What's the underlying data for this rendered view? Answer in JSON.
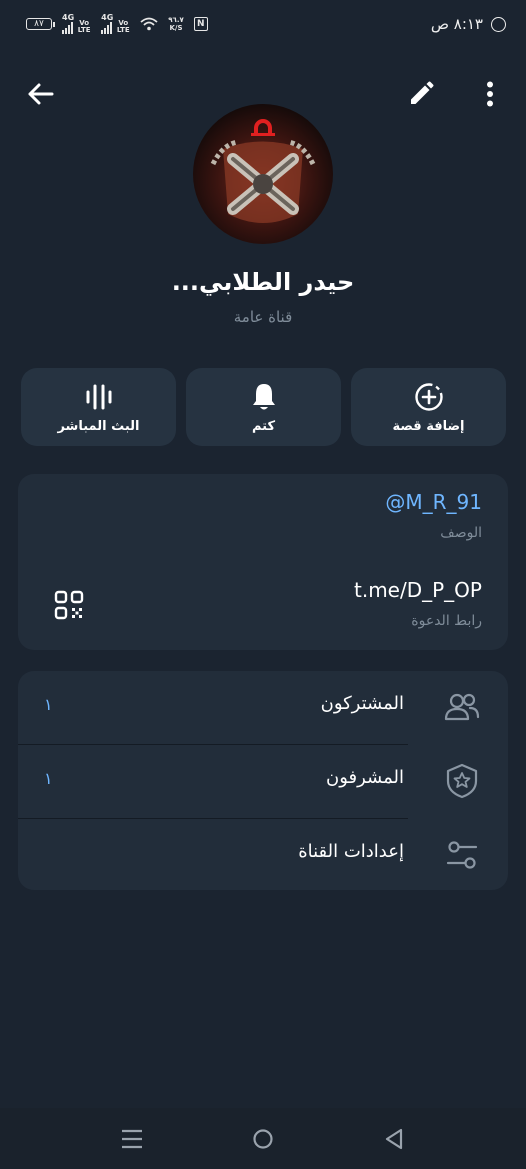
{
  "status_bar": {
    "battery": "٨٧",
    "sim1_net": "4G",
    "sim1_volte": "Vo LTE",
    "sim2_net": "4G",
    "sim2_volte": "Vo LTE",
    "net_speed_value": "٩٦.٧",
    "net_speed_unit": "K/S",
    "nfc": "N",
    "time": "٨:١٣ ص"
  },
  "channel": {
    "name": "حيدر الطلابي...",
    "type": "قناة عامة"
  },
  "actions": [
    {
      "label": "إضافة قصة",
      "icon": "add-story-icon"
    },
    {
      "label": "كتم",
      "icon": "bell-icon"
    },
    {
      "label": "البث المباشر",
      "icon": "live-stream-icon"
    }
  ],
  "info": {
    "username_value": "@M_R_91",
    "username_label": "الوصف",
    "link_value": "t.me/D_P_OP",
    "link_label": "رابط الدعوة"
  },
  "menu": [
    {
      "label": "المشتركون",
      "count": "١",
      "icon": "subscribers-icon"
    },
    {
      "label": "المشرفون",
      "count": "١",
      "icon": "admins-shield-icon"
    },
    {
      "label": "إعدادات القناة",
      "count": "",
      "icon": "settings-sliders-icon"
    }
  ],
  "colors": {
    "background": "#1b2430",
    "card": "#222d3a",
    "action_button": "#263341",
    "link_accent": "#6fb6ff",
    "secondary_text": "#7f8c99"
  }
}
